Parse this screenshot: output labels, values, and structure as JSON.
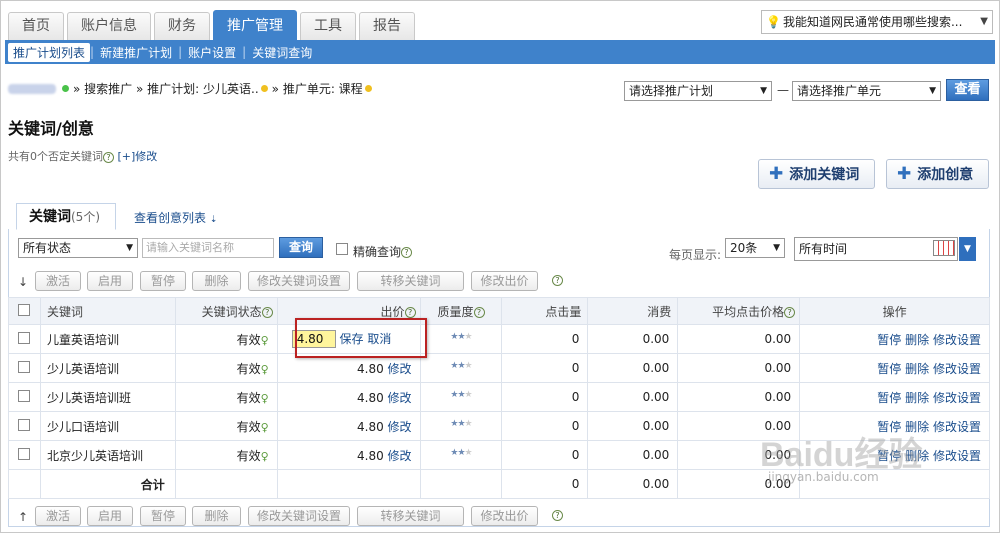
{
  "topnav": {
    "tabs": [
      {
        "label": "首页"
      },
      {
        "label": "账户信息"
      },
      {
        "label": "财务"
      },
      {
        "label": "推广管理"
      },
      {
        "label": "工具"
      },
      {
        "label": "报告"
      }
    ],
    "search_text": "我能知道网民通常使用哪些搜索..."
  },
  "subnav": {
    "items": [
      "推广计划列表",
      "新建推广计划",
      "账户设置",
      "关键词查询"
    ]
  },
  "breadcrumb": {
    "search_promo": "» 搜索推广",
    "plan": "» 推广计划: 少儿英语..",
    "unit": "» 推广单元: 课程"
  },
  "selectors": {
    "plan_select": "请选择推广计划",
    "dash": "—",
    "unit_select": "请选择推广单元",
    "view_btn": "查看"
  },
  "page": {
    "title": "关键词/创意",
    "neg_info": "共有0个否定关键词",
    "modify_link": "[+]修改",
    "add_keyword": "添加关键词",
    "add_creative": "添加创意"
  },
  "panel": {
    "tab_keywords": "关键词",
    "tab_keywords_count": "(5个)",
    "tab_creatives": "查看创意列表",
    "status_select": "所有状态",
    "keyword_placeholder": "请输入关键词名称",
    "query_btn": "查询",
    "exact_query": "精确查询",
    "per_page_label": "每页显示:",
    "per_page_value": "20条",
    "time_select": "所有时间"
  },
  "actions": [
    "激活",
    "启用",
    "暂停",
    "删除",
    "修改关键词设置",
    "转移关键词",
    "修改出价"
  ],
  "table": {
    "headers": [
      "关键词",
      "关键词状态",
      "出价",
      "质量度",
      "点击量",
      "消费",
      "平均点击价格",
      "操作"
    ],
    "rows": [
      {
        "keyword": "儿童英语培训",
        "status": "有效",
        "bid": "4.80",
        "clicks": "0",
        "cost": "0.00",
        "avg": "0.00",
        "editing": true,
        "save": "保存",
        "cancel": "取消"
      },
      {
        "keyword": "少儿英语培训",
        "status": "有效",
        "bid": "4.80",
        "clicks": "0",
        "cost": "0.00",
        "avg": "0.00",
        "edit": "修改"
      },
      {
        "keyword": "少儿英语培训班",
        "status": "有效",
        "bid": "4.80",
        "clicks": "0",
        "cost": "0.00",
        "avg": "0.00",
        "edit": "修改"
      },
      {
        "keyword": "少儿口语培训",
        "status": "有效",
        "bid": "4.80",
        "clicks": "0",
        "cost": "0.00",
        "avg": "0.00",
        "edit": "修改"
      },
      {
        "keyword": "北京少儿英语培训",
        "status": "有效",
        "bid": "4.80",
        "clicks": "0",
        "cost": "0.00",
        "avg": "0.00",
        "edit": "修改"
      }
    ],
    "ops": [
      "暂停",
      "删除",
      "修改设置"
    ],
    "total_label": "合计",
    "total_clicks": "0",
    "total_cost": "0.00",
    "total_avg": "0.00"
  },
  "watermark": {
    "brand": "Baidu经验",
    "url": "jingyan.baidu.com"
  },
  "colors": {
    "nav_blue": "#3f82cb",
    "link": "#1a4d8c",
    "highlight": "#fff59c",
    "red_box": "#b22222"
  }
}
